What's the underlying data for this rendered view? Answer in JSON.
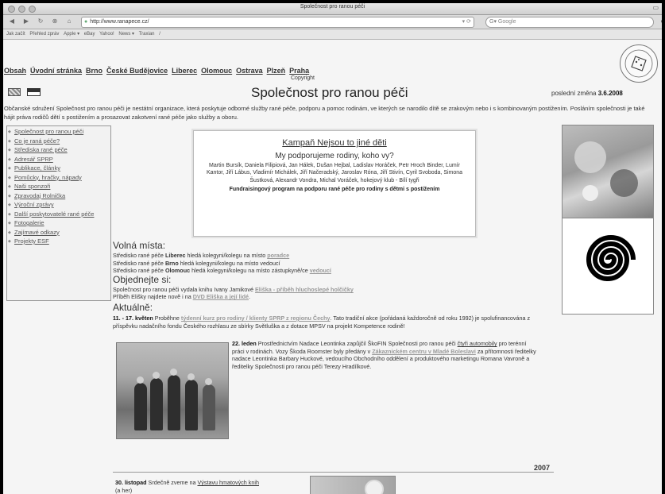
{
  "browser": {
    "window_title": "Společnost pro ranou péči",
    "url": "http://www.ranapece.cz/",
    "search_placeholder": "Google",
    "bookmarks": [
      "Jak začít",
      "Přehled zpráv",
      "Apple ▾",
      "eBay",
      "Yahoo!",
      "News ▾",
      "Traxian",
      "/"
    ]
  },
  "header": {
    "nav_links": [
      "Obsah",
      "Úvodní stránka",
      "Brno",
      "České Budějovice",
      "Liberec",
      "Olomouc",
      "Ostrava",
      "Plzeň",
      "Praha"
    ],
    "copyright": "Copyright",
    "title": "Společnost pro ranou péči",
    "last_change_label": "poslední změna",
    "last_change_date": "3.6.2008",
    "logo_text": "SPOLEČNOST PRO RANOU PÉČI"
  },
  "intro": "Občanské sdružení Společnost pro ranou péči je nestátní organizace, která poskytuje odborné služby rané péče, podporu a pomoc rodinám, ve kterých se narodilo dítě se zrakovým nebo i s kombinovaným postižením. Posláním společnosti je také hájit práva rodičů dětí s postižením a prosazovat zakotvení rané péče jako služby a oboru.",
  "sidebar": {
    "items": [
      "Společnost pro ranou péči",
      "Co je raná péče?",
      "Střediska rané péče",
      "Adresář SPRP",
      "Publikace, články",
      "Pomůcky, hračky, nápady",
      "Naši sponzoři",
      "Zpravodaj Rolnička",
      "Výroční zprávy",
      "Další poskytovatelé rané péče",
      "Fotogalerie",
      "Zajímavé odkazy",
      "Projekty ESF"
    ]
  },
  "campaign": {
    "title": "Kampaň Nejsou to jiné děti",
    "subtitle": "My podporujeme rodiny, koho vy?",
    "names": "Martin Bursík, Daniela Filipiová, Jan Hálek, Dušan Hejbal, Ladislav Horáček, Petr Hroch Binder, Lumír Kantor, Jiří Lábus, Vladimír Michálek, Jiří Načeradský, Jaroslav Róna, Jiří Stivín, Cyril Svoboda, Simona Šustková, Alexandr Vondra, Michal Voráček, hokejový klub - Bílí tygři",
    "footer": "Fundraisingový program na podporu rané péče pro rodiny s dětmi s postižením"
  },
  "volna_mista": {
    "heading": "Volná místa:",
    "lines": [
      {
        "pre": "Středisko rané péče ",
        "city": "Liberec",
        "mid": " hledá kolegyni/kolegu na místo ",
        "link": "poradce"
      },
      {
        "pre": "Středisko rané péče ",
        "city": "Brno",
        "mid": " hledá kolegyni/kolegu na místo vedoucí",
        "link": ""
      },
      {
        "pre": "Středisko rané péče ",
        "city": "Olomouc",
        "mid": " hledá kolegyni/kolegu na místo zástupkyně/ce ",
        "link": "vedoucí"
      }
    ]
  },
  "objednejte": {
    "heading": "Objednejte si:",
    "line1_pre": "Společnost pro ranou péči vydala knihu Ivany Jamikové ",
    "line1_link": "Eliška - příběh hluchoslepé holčičky",
    "line2_pre": "Příběh Elišky najdete nově i na ",
    "line2_link": "DVD Eliška a její lidé",
    "line2_post": "."
  },
  "aktualne": {
    "heading": "Aktuálně:",
    "news1_date": "11. - 17. květen",
    "news1_pre": " Proběhne ",
    "news1_link": "týdenní kurz pro rodiny / klienty SPRP z regionu Čechy",
    "news1_post": ". Tato tradiční akce (pořádaná každoročně od roku 1992) je spolufinancována z příspěvku nadačního fondu Českého rozhlasu ze sbírky Světluška a z dotace MPSV na projekt Kompetence rodině!",
    "news2_date": "22. leden",
    "news2_pre": " Prostřednictvím Nadace Leontinka zapůjčil ŠkoFIN Společnosti pro ranou péči ",
    "news2_link1": "čtyři automobily",
    "news2_mid": " pro terénní práci v rodinách. Vozy Škoda Roomster byly předány v ",
    "news2_link2": "Zákaznickém centru v Mladé Boleslavi",
    "news2_post": " za přítomnosti ředitelky nadace Leontinka Barbary Huckové, vedoucího Obchodního oddělení a produktového marketingu Romana Vavroně a ředitelky Společnosti pro ranou péči Terezy Hradílkové."
  },
  "archive": {
    "year": "2007",
    "news3_date": "30. listopad",
    "news3_pre": " Srdečně zveme na ",
    "news3_link": "Výstavu hmatových knih",
    "news3_post": "(a her)"
  },
  "colors": {
    "link_gray": "#999999",
    "page_bg": "#f5f5f5"
  }
}
